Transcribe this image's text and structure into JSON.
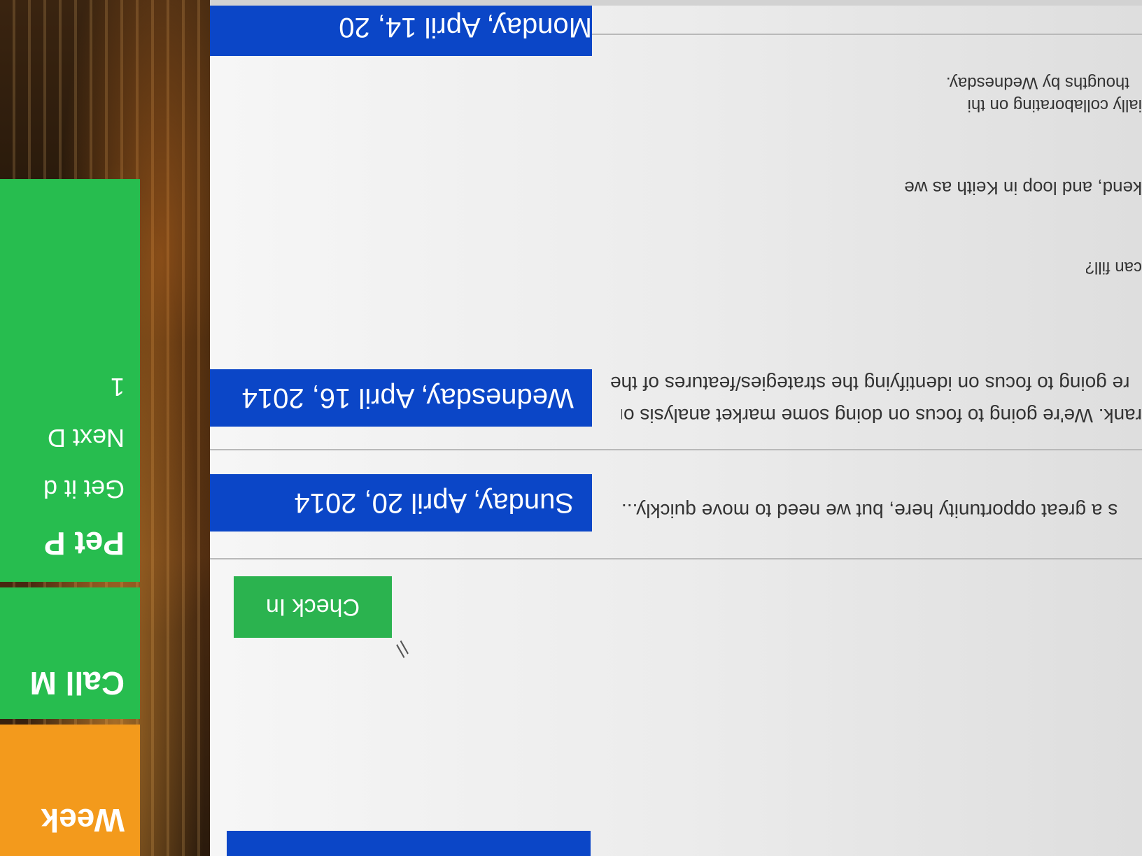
{
  "tiles": {
    "week": {
      "title": "Week"
    },
    "call": {
      "title": "Call M"
    },
    "pet": {
      "title": "Pet P",
      "line1": "Get it d",
      "line2": "Next D",
      "count": "1"
    }
  },
  "check_in": {
    "label": "Check In"
  },
  "tasks": [
    {
      "date": "Sunday, April 20, 2014",
      "note": "s a great opportunity here, but we need to move quickly..."
    },
    {
      "date": "Wednesday, April 16, 2014",
      "note_line1": "rank. We're going to focus on doing some market analysis on the",
      "note_line2": "re going to focus on identifying the strategies/features of the"
    }
  ],
  "notes": {
    "question": "can fill?",
    "weekend": "kend, and loop in Keith as well.",
    "collab_line1": "ially collaborating on this.",
    "collab_line2": "thougths by Wednesday."
  },
  "last_date": "Monday, April 14, 20",
  "colors": {
    "orange_tile": "#f39a1c",
    "green_tile": "#27bd4f",
    "blue_bar": "#0b46c7",
    "check_in_green": "#2bb34f"
  }
}
